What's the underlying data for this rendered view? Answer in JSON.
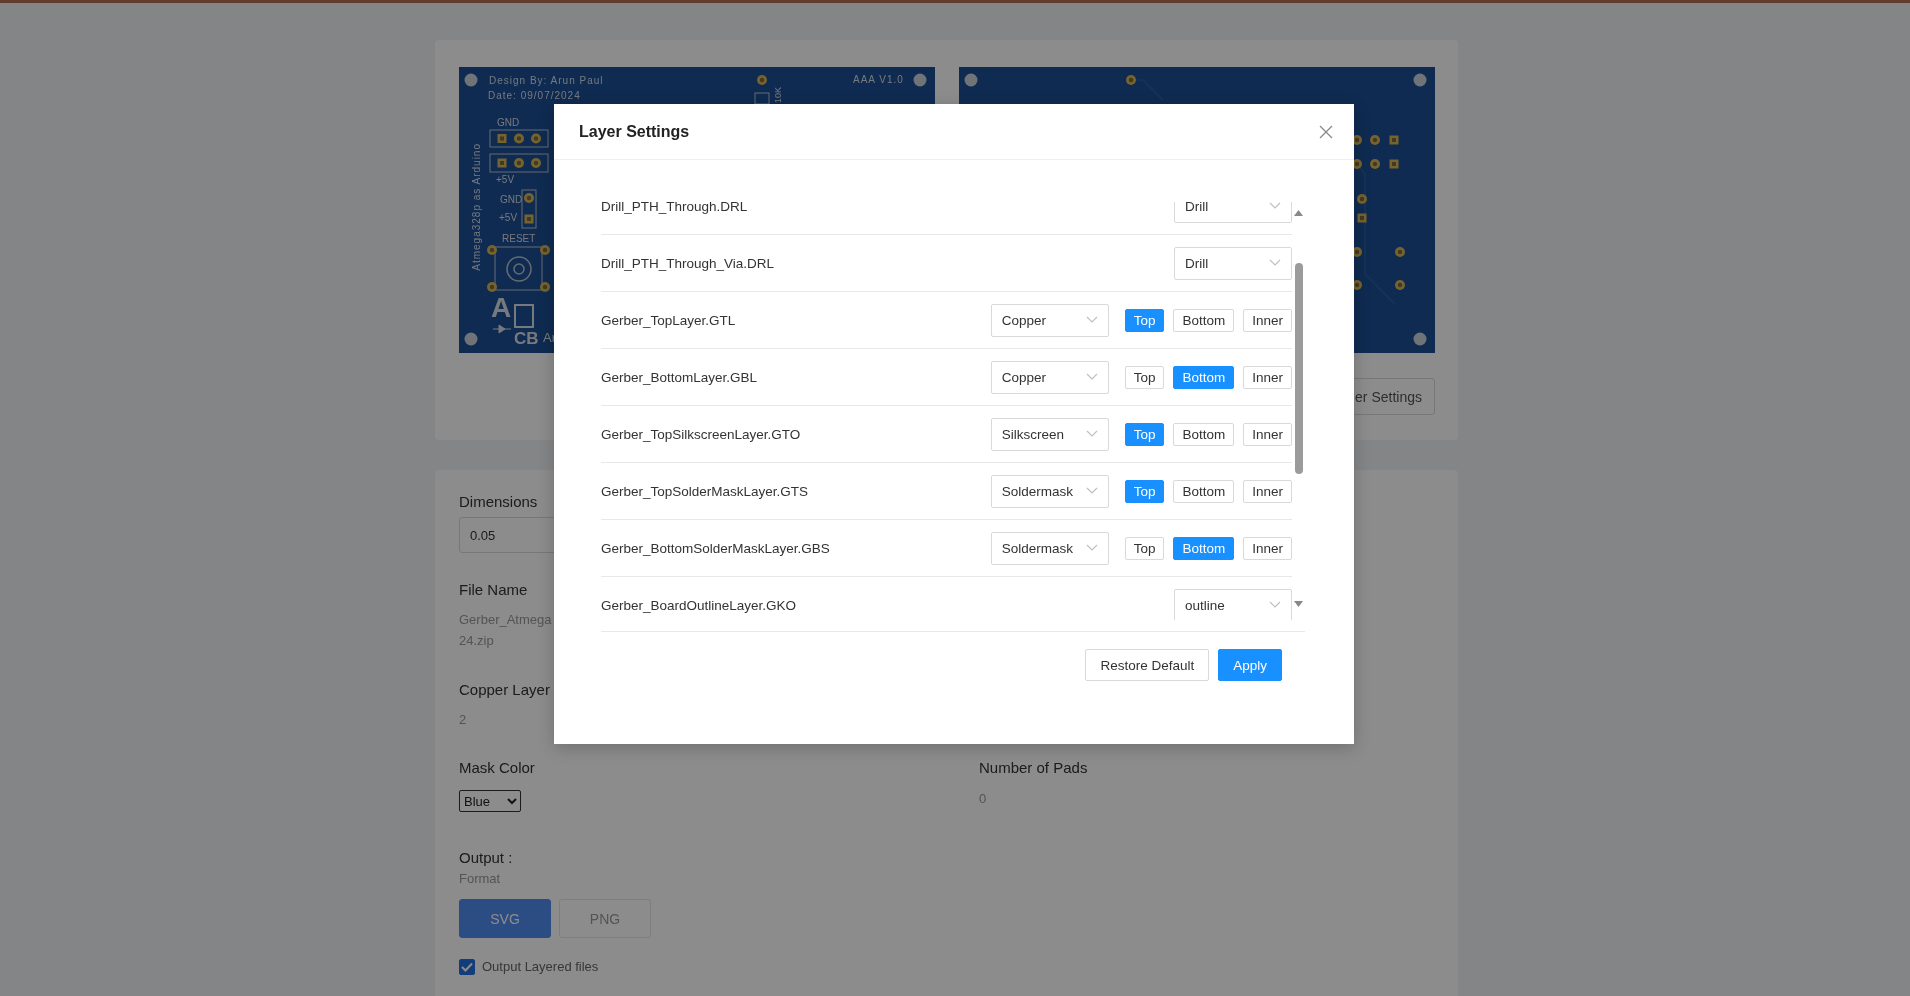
{
  "preview": {
    "top_board": {
      "design_by": "Design By: Arun Paul",
      "date": "Date: 09/07/2024",
      "version": "AAA V1.0",
      "resistor": "10K",
      "labels": [
        "GND",
        "+5V",
        "GND",
        "+5V",
        "RESET"
      ],
      "side_text": "Atmega328p as Arduino",
      "logo": [
        "A",
        "CB",
        "Ar"
      ]
    },
    "layer_settings_button": "er Settings"
  },
  "details": {
    "dimensions": {
      "label": "Dimensions",
      "value": "0.05"
    },
    "file_name": {
      "label": "File Name",
      "lines": [
        "Gerber_Atmega",
        "24.zip"
      ]
    },
    "copper_layers": {
      "label": "Copper Layer",
      "value": "2"
    },
    "mask_color": {
      "label": "Mask Color",
      "value": "Blue"
    },
    "number_of_pads": {
      "label": "Number of Pads",
      "value": "0"
    },
    "output": {
      "label": "Output :",
      "format_label": "Format",
      "formats": [
        {
          "label": "SVG",
          "selected": true
        },
        {
          "label": "PNG",
          "selected": false
        }
      ],
      "layered": {
        "label": "Output Layered files",
        "checked": true
      }
    }
  },
  "modal": {
    "title": "Layer Settings",
    "rows": [
      {
        "name": "Drill_PTH_Through.DRL",
        "type": "Drill"
      },
      {
        "name": "Drill_PTH_Through_Via.DRL",
        "type": "Drill"
      },
      {
        "name": "Gerber_TopLayer.GTL",
        "type": "Copper",
        "sides": [
          {
            "label": "Top",
            "selected": true
          },
          {
            "label": "Bottom",
            "selected": false
          },
          {
            "label": "Inner",
            "selected": false
          }
        ]
      },
      {
        "name": "Gerber_BottomLayer.GBL",
        "type": "Copper",
        "sides": [
          {
            "label": "Top",
            "selected": false
          },
          {
            "label": "Bottom",
            "selected": true
          },
          {
            "label": "Inner",
            "selected": false
          }
        ]
      },
      {
        "name": "Gerber_TopSilkscreenLayer.GTO",
        "type": "Silkscreen",
        "sides": [
          {
            "label": "Top",
            "selected": true
          },
          {
            "label": "Bottom",
            "selected": false
          },
          {
            "label": "Inner",
            "selected": false
          }
        ]
      },
      {
        "name": "Gerber_TopSolderMaskLayer.GTS",
        "type": "Soldermask",
        "sides": [
          {
            "label": "Top",
            "selected": true
          },
          {
            "label": "Bottom",
            "selected": false
          },
          {
            "label": "Inner",
            "selected": false
          }
        ]
      },
      {
        "name": "Gerber_BottomSolderMaskLayer.GBS",
        "type": "Soldermask",
        "sides": [
          {
            "label": "Top",
            "selected": false
          },
          {
            "label": "Bottom",
            "selected": true
          },
          {
            "label": "Inner",
            "selected": false
          }
        ]
      },
      {
        "name": "Gerber_BoardOutlineLayer.GKO",
        "type": "outline"
      }
    ],
    "buttons": [
      "Restore Default",
      "Apply"
    ]
  }
}
